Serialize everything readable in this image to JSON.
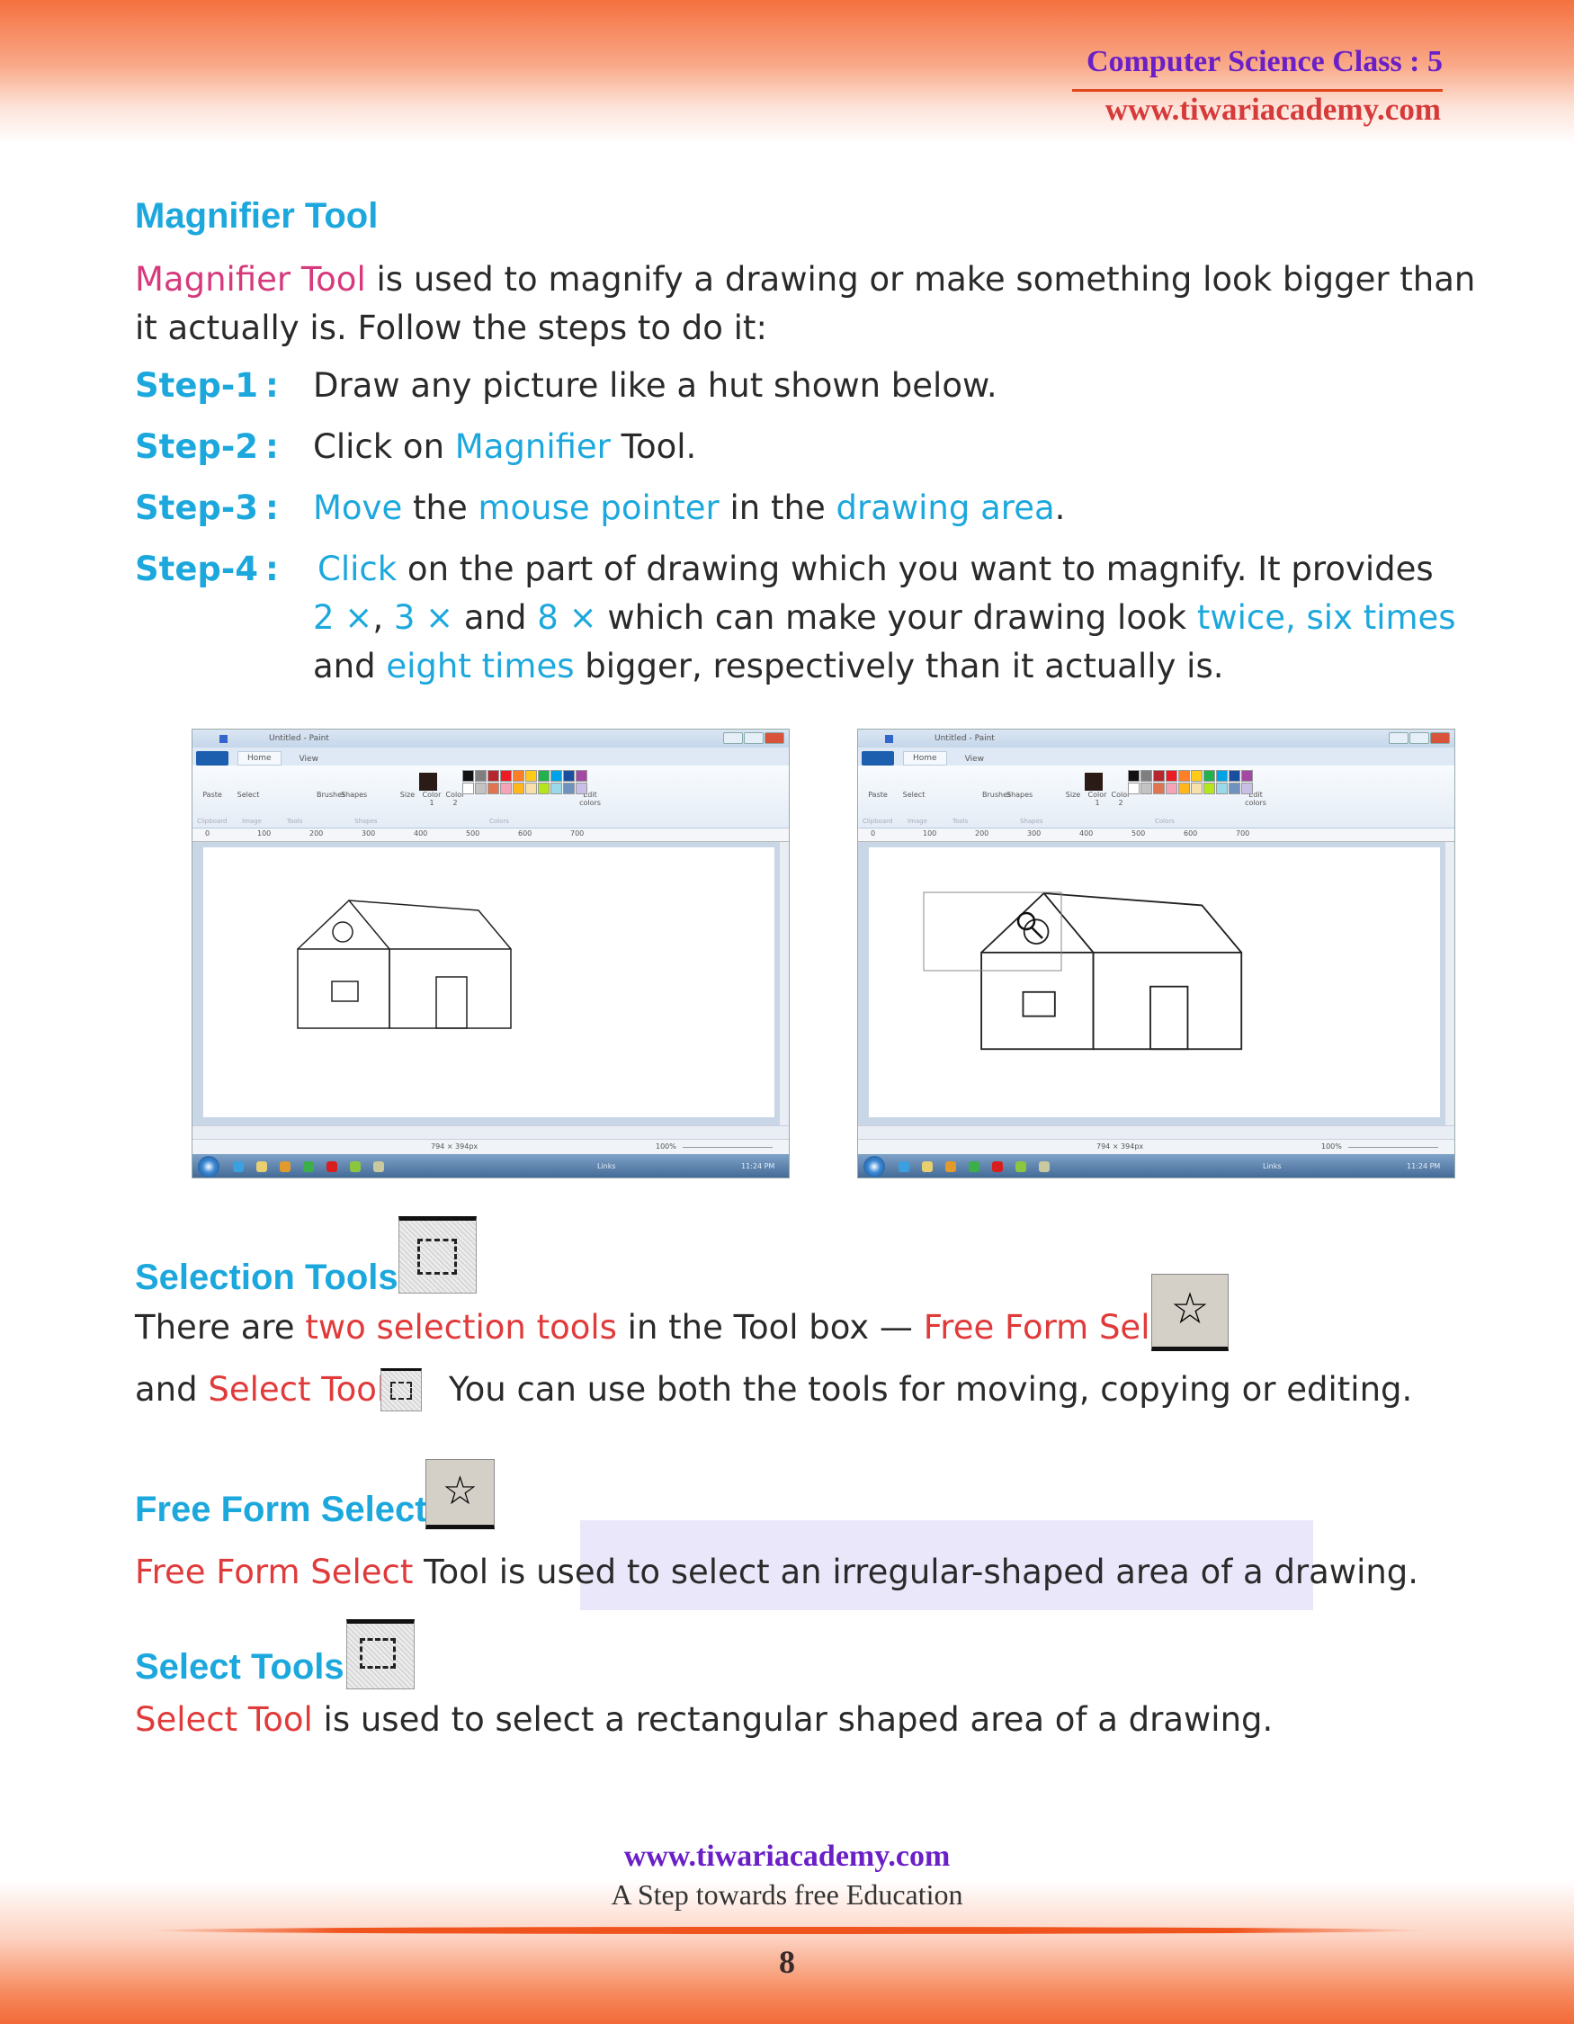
{
  "header": {
    "title": "Computer Science Class : 5",
    "website": "www.tiwariacademy.com"
  },
  "magnifier": {
    "heading": "Magnifier Tool",
    "intro_highlight": "Magnifier Tool",
    "intro_rest": " is used to magnify a drawing or make something look bigger than",
    "intro_line2": "it actually is. Follow the steps to do it:",
    "steps": [
      {
        "label": "Step-1",
        "colon": ":",
        "parts": [
          "Draw any picture like a hut shown below."
        ]
      },
      {
        "label": "Step-2",
        "colon": ":",
        "parts": [
          "Click on ",
          "Magnifier",
          " Tool."
        ]
      },
      {
        "label": "Step-3",
        "colon": ":",
        "parts": [
          "Move",
          " the ",
          "mouse pointer",
          " in the ",
          "drawing area",
          "."
        ]
      },
      {
        "label": "Step-4",
        "colon": ":",
        "parts": [
          "Click",
          " on the part of drawing which you want to magnify. It provides"
        ],
        "line2": [
          "2 ×",
          ", ",
          "3 ×",
          " and ",
          "8 ×",
          " which can make your drawing look ",
          "twice, six times"
        ],
        "line3": [
          "and ",
          "eight times",
          " bigger, respectively than it actually is."
        ]
      }
    ]
  },
  "paint": {
    "title": "Untitled - Paint",
    "tabs": [
      "Home",
      "View"
    ],
    "tools": [
      "Paste",
      "Select",
      "Brushes",
      "Shapes",
      "Size",
      "Color 1",
      "Color 2",
      "Edit colors"
    ],
    "groups": [
      "Clipboard",
      "Image",
      "Tools",
      "Shapes",
      "Colors"
    ],
    "ruler": [
      "0",
      "100",
      "200",
      "300",
      "400",
      "500",
      "600",
      "700"
    ],
    "palette": [
      "#111111",
      "#7f7f7f",
      "#b5272d",
      "#ec1c24",
      "#ff7f27",
      "#ffca18",
      "#22b14c",
      "#00a2e8",
      "#1a4fa0",
      "#a349a4",
      "#ffffff",
      "#c3c3c3",
      "#e17551",
      "#f5a3b6",
      "#ffb71c",
      "#f8e0aa",
      "#b5e61d",
      "#99d9ea",
      "#7092be",
      "#c8bfe7"
    ],
    "color1": "#2b1b17",
    "size": "794 × 394px",
    "zoom": "100%",
    "links": "Links",
    "time": "11:24 PM"
  },
  "selection": {
    "heading": "Selection Tools",
    "line1": [
      "There are ",
      "two selection tools",
      " in the Tool box — ",
      "Free Form Select"
    ],
    "line2": [
      "and ",
      "Select Tool",
      " You can use both the tools for moving, copying or editing."
    ]
  },
  "freeform": {
    "heading": "Free Form Select",
    "line": [
      "Free Form Select",
      " Tool is used to select an irregular-shaped area of a drawing."
    ]
  },
  "select": {
    "heading": "Select Tools",
    "line": [
      "Select Tool",
      " is used to select a rectangular shaped area of a drawing."
    ]
  },
  "footer": {
    "website": "www.tiwariacademy.com",
    "tagline": "A Step towards free Education",
    "page": "8"
  }
}
